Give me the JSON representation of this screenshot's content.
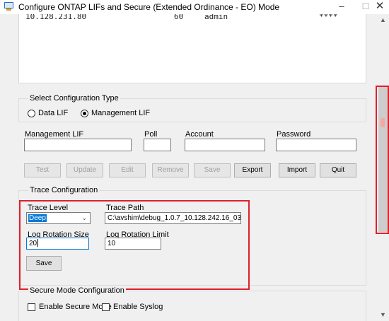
{
  "window": {
    "title": "Configure ONTAP LIFs and Secure (Extended Ordinance - EO) Mode",
    "minimize_glyph": "–",
    "maximize_glyph": "☐",
    "close_glyph": "✕"
  },
  "list": {
    "row1": {
      "address": "10.128.231.80",
      "poll": "60",
      "account": "admin",
      "password": "****"
    }
  },
  "config_type": {
    "title": "Select Configuration Type",
    "option_data_lif": "Data LIF",
    "option_management_lif": "Management LIF",
    "selected": "Management LIF"
  },
  "fields": {
    "management_lif_label": "Management LIF",
    "management_lif_value": "",
    "poll_label": "Poll",
    "poll_value": "",
    "account_label": "Account",
    "account_value": "",
    "password_label": "Password",
    "password_value": ""
  },
  "actions": {
    "test": "Test",
    "update": "Update",
    "edit": "Edit",
    "remove": "Remove",
    "save": "Save",
    "export": "Export",
    "import": "Import",
    "quit": "Quit"
  },
  "trace": {
    "title": "Trace Configuration",
    "level_label": "Trace Level",
    "level_value": "Deep",
    "path_label": "Trace Path",
    "path_value": "C:\\avshim\\debug_1.0.7_10.128.242.16_03",
    "rotation_size_label": "Log Rotation Size",
    "rotation_size_value": "20",
    "rotation_limit_label": "Log Rotation Limit",
    "rotation_limit_value": "10",
    "save_label": "Save"
  },
  "secure_mode": {
    "title": "Secure Mode Configuration",
    "enable_secure_mode": "Enable Secure Mode",
    "enable_syslog": "Enable Syslog"
  },
  "colors": {
    "annotation": "#e0202a",
    "selection": "#0078d7"
  }
}
